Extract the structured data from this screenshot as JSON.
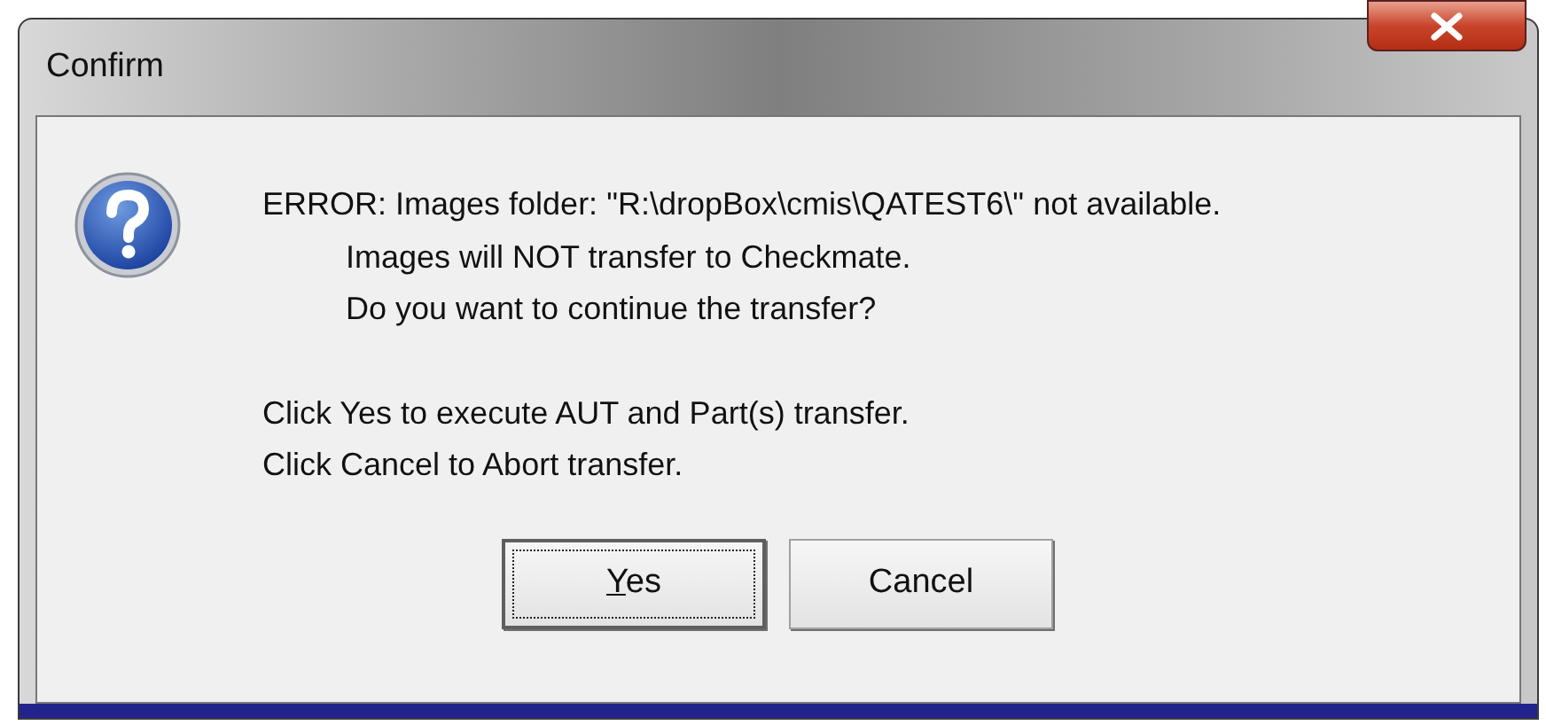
{
  "window": {
    "title": "Confirm"
  },
  "message": {
    "lines": [
      {
        "text": "ERROR: Images folder: \"R:\\dropBox\\cmis\\QATEST6\\\" not available.",
        "indent": false
      },
      {
        "text": "Images will NOT transfer to Checkmate.",
        "indent": true
      },
      {
        "text": "Do you want to continue the transfer?",
        "indent": true
      }
    ],
    "notes": [
      "Click Yes to execute AUT and Part(s) transfer.",
      "Click Cancel to Abort transfer."
    ]
  },
  "buttons": [
    {
      "label": "Yes",
      "focused": true,
      "mnemonic": true
    },
    {
      "label": "Cancel",
      "focused": false,
      "mnemonic": false
    }
  ]
}
